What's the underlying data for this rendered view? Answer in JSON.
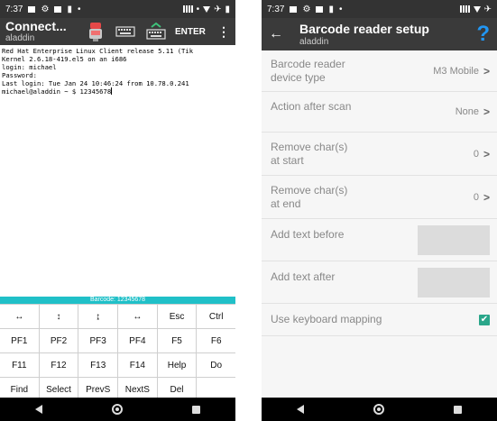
{
  "left": {
    "status": {
      "time": "7:37"
    },
    "appbar": {
      "title": "Connect...",
      "subtitle": "aladdin",
      "enter_label": "ENTER"
    },
    "terminal_lines": [
      "Red Hat Enterprise Linux Client release 5.11 (Tik",
      "Kernel 2.6.18-419.el5 on an i686",
      "login: michael",
      "Password:",
      "Last login: Tue Jan 24 10:46:24 from 10.78.0.241",
      "michael@aladdin ~ $ 12345678"
    ],
    "barcode_strip": "Barcode: 12345678",
    "keypad": [
      [
        "↔",
        "↕",
        "↨",
        "↔",
        "Esc",
        "Ctrl"
      ],
      [
        "PF1",
        "PF2",
        "PF3",
        "PF4",
        "F5",
        "F6"
      ],
      [
        "F11",
        "F12",
        "F13",
        "F14",
        "Help",
        "Do"
      ],
      [
        "Find",
        "Select",
        "PrevS",
        "NextS",
        "Del",
        ""
      ]
    ]
  },
  "right": {
    "status": {
      "time": "7:37"
    },
    "appbar": {
      "title": "Barcode reader setup",
      "subtitle": "aladdin",
      "help_glyph": "?"
    },
    "settings": {
      "device_type": {
        "label_line1": "Barcode reader",
        "label_line2": "device type",
        "value": "M3 Mobile"
      },
      "action_after_scan": {
        "label": "Action after scan",
        "value": "None"
      },
      "remove_start": {
        "label_line1": "Remove char(s)",
        "label_line2": "at start",
        "value": "0"
      },
      "remove_end": {
        "label_line1": "Remove char(s)",
        "label_line2": "at end",
        "value": "0"
      },
      "add_before": {
        "label": "Add text before",
        "value": ""
      },
      "add_after": {
        "label": "Add text after",
        "value": ""
      },
      "keyboard_mapping": {
        "label": "Use keyboard mapping",
        "checked": true
      }
    },
    "chevron": ">",
    "checkmark": "✔"
  },
  "colors": {
    "statusbar": "#333333",
    "appbar": "#3a3a3a",
    "barcode_strip": "#20c0c8",
    "help": "#2196f3",
    "checkbox": "#2aa68a"
  }
}
